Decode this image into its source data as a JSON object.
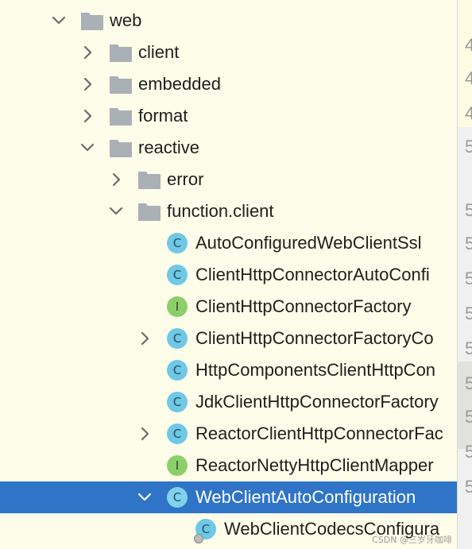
{
  "tree": {
    "rows": [
      {
        "label": "web",
        "kind": "folder",
        "expanded": true
      },
      {
        "label": "client",
        "kind": "folder",
        "expanded": false
      },
      {
        "label": "embedded",
        "kind": "folder",
        "expanded": false
      },
      {
        "label": "format",
        "kind": "folder",
        "expanded": false
      },
      {
        "label": "reactive",
        "kind": "folder",
        "expanded": true
      },
      {
        "label": "error",
        "kind": "folder",
        "expanded": false
      },
      {
        "label": "function.client",
        "kind": "folder",
        "expanded": true
      },
      {
        "label": "AutoConfiguredWebClientSsl",
        "kind": "class",
        "icon_letter": "C"
      },
      {
        "label": "ClientHttpConnectorAutoConfi",
        "kind": "class",
        "icon_letter": "C"
      },
      {
        "label": "ClientHttpConnectorFactory",
        "kind": "interface",
        "icon_letter": "I"
      },
      {
        "label": "ClientHttpConnectorFactoryCo",
        "kind": "class",
        "icon_letter": "C",
        "expanded": false
      },
      {
        "label": "HttpComponentsClientHttpCon",
        "kind": "class",
        "icon_letter": "C"
      },
      {
        "label": "JdkClientHttpConnectorFactory",
        "kind": "class",
        "icon_letter": "C"
      },
      {
        "label": "ReactorClientHttpConnectorFac",
        "kind": "class",
        "icon_letter": "C",
        "expanded": false
      },
      {
        "label": "ReactorNettyHttpClientMapper",
        "kind": "interface",
        "icon_letter": "I"
      },
      {
        "label": "WebClientAutoConfiguration",
        "kind": "class",
        "icon_letter": "C",
        "expanded": true,
        "selected": true
      },
      {
        "label": "WebClientCodecsConfigura",
        "kind": "class",
        "icon_letter": "C"
      }
    ]
  },
  "gutter": {
    "line_numbers": [
      "4",
      "4",
      "4",
      "5",
      "5",
      "5",
      "5",
      "5",
      "5",
      "5",
      "5",
      "5",
      "5"
    ]
  },
  "watermark": "CSDN @三岁牙咖啡",
  "colors": {
    "background": "#fefde9",
    "selection": "#2f74c6",
    "class_icon": "#6ec8e6",
    "interface_icon": "#8ccf6a",
    "folder": "#a9b1b6"
  },
  "icons": {
    "folder": "folder-icon",
    "class": "class-icon",
    "interface": "interface-icon",
    "expand": "chevron-right-icon",
    "collapse": "chevron-down-icon"
  }
}
